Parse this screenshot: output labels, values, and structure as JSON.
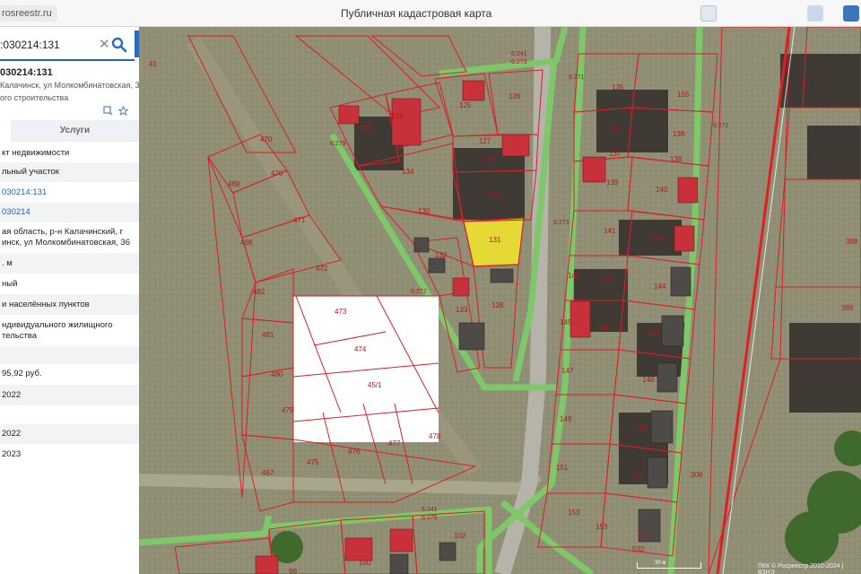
{
  "header": {
    "url": "rosreestr.ru",
    "title": "Публичная кадастровая карта"
  },
  "search": {
    "value": ":030214:131",
    "clear_icon": "close-icon",
    "search_icon": "search-icon"
  },
  "panel": {
    "collapse_glyph": "‹",
    "cadastral_number": "030214:131",
    "address_short": "Калачинск, ул Молкомбинатовская, 36",
    "purpose_short": "ого строительства",
    "tabs": [
      "",
      "Услуги"
    ],
    "rows": [
      {
        "text": "кт недвижимости",
        "type": "plain"
      },
      {
        "text": "льный участок",
        "type": "plain"
      },
      {
        "text": "030214:131",
        "type": "link"
      },
      {
        "text": "030214",
        "type": "link"
      },
      {
        "text": "ая область, р-н Калачинский, г\nинск, ул Молкомбинатовская, 36",
        "type": "plain"
      },
      {
        "text": ". м",
        "type": "plain"
      },
      {
        "text": "ный",
        "type": "plain"
      },
      {
        "text": "и населённых пунктов",
        "type": "plain"
      },
      {
        "text": "ндивидуального жилищного\nтельства",
        "type": "plain"
      },
      {
        "text": "",
        "type": "plain"
      },
      {
        "text": "95,92 руб.",
        "type": "plain"
      },
      {
        "text": "2022",
        "type": "plain"
      },
      {
        "text": "",
        "type": "plain"
      },
      {
        "text": "2022",
        "type": "plain"
      },
      {
        "text": "2023",
        "type": "plain"
      }
    ]
  },
  "map": {
    "selected_parcel": "131",
    "colors": {
      "parcel_border": "#d91f26",
      "road_fill": "#7ec86a",
      "selected_fill": "#f4e62a",
      "ground": "#8d8c74",
      "roof": "#c8303a"
    },
    "labels": [
      "41",
      "470",
      "469",
      "470",
      "471",
      "468",
      "472",
      "482",
      "473",
      "474",
      "481",
      "480",
      "45/1",
      "479",
      "477",
      "478",
      "467",
      "475",
      "476",
      "123",
      "124",
      "125",
      "126",
      "127",
      "127",
      "129",
      "134",
      "130",
      "131",
      "132",
      "133",
      "128",
      "135",
      "155",
      "137",
      "138",
      "137",
      "139",
      "140",
      "141",
      "142",
      "143",
      "144",
      "143",
      "145",
      "145",
      "146",
      "147",
      "148",
      "149",
      "150",
      "151",
      "152",
      "153",
      "154",
      "532",
      "388",
      "389",
      "308",
      "102",
      "100",
      "99",
      "6:241",
      "6:273",
      "6:271",
      "6:279",
      "6:272",
      "6:273",
      "6:277",
      "6:241",
      "6:275"
    ],
    "copyright": "ПКК © Росреестр 2010-2024 | ВЗНЭ",
    "scale": "30 м"
  }
}
